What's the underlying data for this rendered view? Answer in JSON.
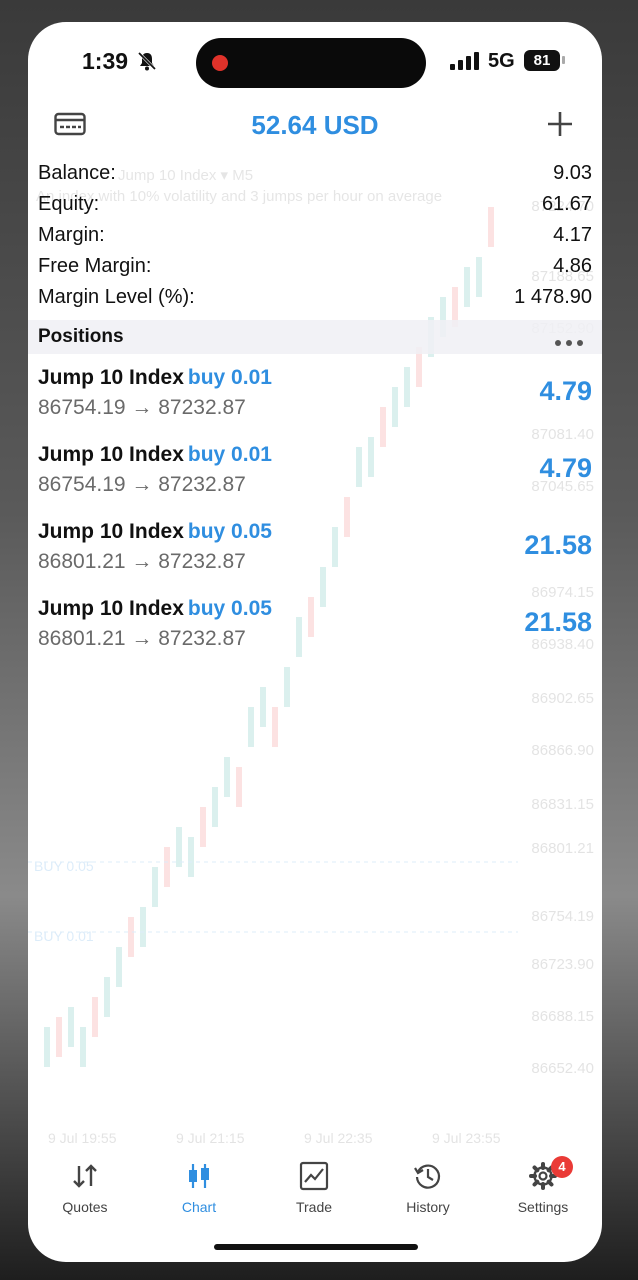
{
  "status_bar": {
    "time": "1:39",
    "network": "5G",
    "battery": "81"
  },
  "header": {
    "title": "52.64 USD",
    "left_icon": "card-icon",
    "right_icon": "plus-icon"
  },
  "account": [
    {
      "label": "Balance:",
      "value": "9.03"
    },
    {
      "label": "Equity:",
      "value": "61.67"
    },
    {
      "label": "Margin:",
      "value": "4.17"
    },
    {
      "label": "Free Margin:",
      "value": "4.86"
    },
    {
      "label": "Margin Level (%):",
      "value": "1 478.90"
    }
  ],
  "positions_header": "Positions",
  "positions": [
    {
      "symbol": "Jump 10 Index",
      "side": "buy 0.01",
      "prices": "86754.19 → 87232.87",
      "profit": "4.79"
    },
    {
      "symbol": "Jump 10 Index",
      "side": "buy 0.01",
      "prices": "86754.19 → 87232.87",
      "profit": "4.79"
    },
    {
      "symbol": "Jump 10 Index",
      "side": "buy 0.05",
      "prices": "86801.21 → 87232.87",
      "profit": "21.58"
    },
    {
      "symbol": "Jump 10 Index",
      "side": "buy 0.05",
      "prices": "86801.21 → 87232.87",
      "profit": "21.58"
    }
  ],
  "background_chart": {
    "symbol": "Jump 10 Index ▾ M5",
    "subtitle": "An index with 10% volatility and 3 jumps per hour on average",
    "price_labels": [
      "87224.70",
      "87188.65",
      "87152.90",
      "87081.40",
      "87045.65",
      "86974.15",
      "86938.40",
      "86902.65",
      "86866.90",
      "86831.15",
      "86801.21",
      "86754.19",
      "86723.90",
      "86688.15",
      "86652.40"
    ],
    "time_labels": [
      "9 Jul 19:55",
      "9 Jul 21:15",
      "9 Jul 22:35",
      "9 Jul 23:55"
    ],
    "trade_lines": [
      "BUY 0.05",
      "BUY 0.01"
    ]
  },
  "tabs": [
    {
      "label": "Quotes",
      "icon": "quotes-arrows-icon"
    },
    {
      "label": "Chart",
      "icon": "chart-candles-icon"
    },
    {
      "label": "Trade",
      "icon": "trade-chart-icon"
    },
    {
      "label": "History",
      "icon": "history-clock-icon"
    },
    {
      "label": "Settings",
      "icon": "gear-icon"
    }
  ],
  "settings_badge": "4",
  "colors": {
    "accent": "#2f8ee0",
    "badge": "#ea3a36"
  }
}
